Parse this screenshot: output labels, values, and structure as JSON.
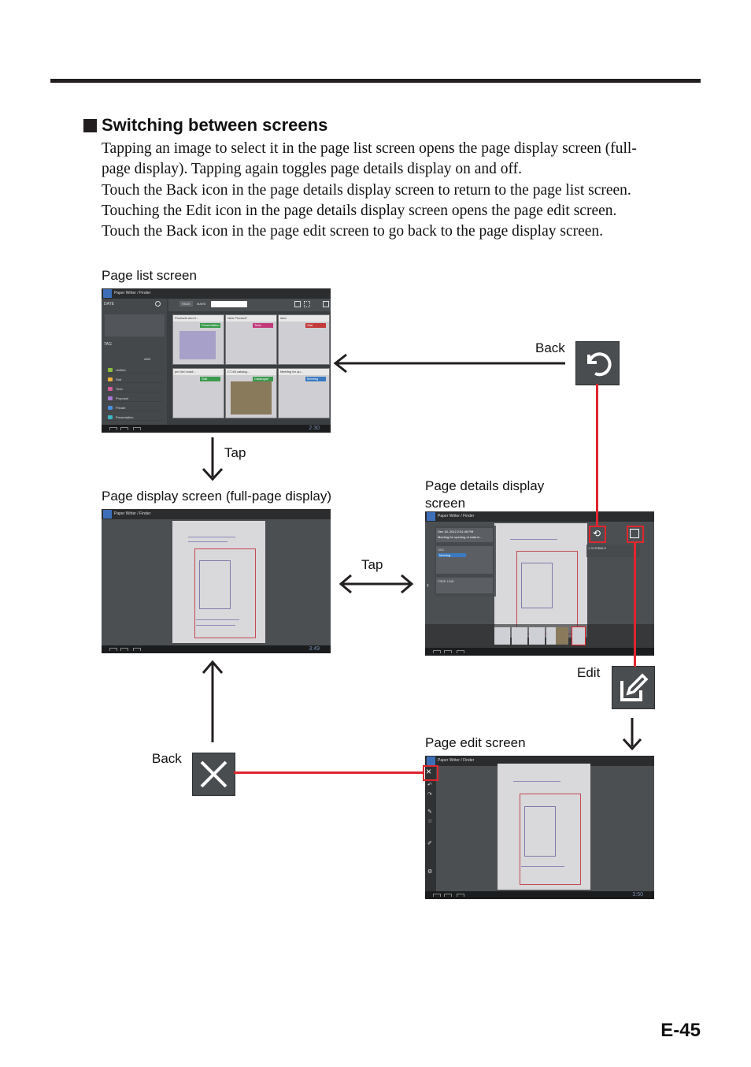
{
  "section": {
    "title": "Switching between screens",
    "paragraph_lines": [
      "Tapping an image to select it in the page list screen opens the page display screen (full-",
      "page display). Tapping again toggles page details display on and off.",
      "Touch the Back icon in the page details display screen to return to the page list screen.",
      "Touching the Edit icon in the page details display screen opens the page edit screen.",
      "Touch the Back icon in the page edit screen to go back to the page display screen."
    ]
  },
  "labels": {
    "page_list": "Page list screen",
    "page_display": "Page display screen (full-page display)",
    "page_details_1": "Page details display",
    "page_details_2": "screen",
    "page_edit": "Page edit screen",
    "tap_down": "Tap",
    "tap_side": "Tap",
    "back_top": "Back",
    "edit": "Edit",
    "back_bottom": "Back"
  },
  "app_title": "Paper Writer / Finder",
  "page_list_screen": {
    "date_label": "DATE",
    "tag_label": "TAG",
    "tab_page": "PAGE",
    "tab_mark": "MARK",
    "and_label": "AND",
    "tags": [
      "Unfiled",
      "Stat",
      "Todo",
      "Proposal",
      "Private",
      "Presentation"
    ],
    "thumbs": [
      {
        "date": "Dec 19, 2012",
        "title": "Products and ti...",
        "tag": "Presentation"
      },
      {
        "date": "Dec 19, 2012",
        "title": "New Product?",
        "tag": "Todo"
      },
      {
        "date": "Dec 18, 2012",
        "title": "idea",
        "tag": "Stat"
      },
      {
        "date": "Dec 19, 2012",
        "title": "pm 3rd Leadi...",
        "tag": "Stat"
      },
      {
        "date": "Dec 19, 2012",
        "title": "CT-63 catalog...",
        "tag": "Catalogue"
      },
      {
        "date": "Dec 18, 2012",
        "title": "Meeting for op...",
        "tag": "Meeting"
      }
    ],
    "clock": "2:30"
  },
  "page_display_screen": {
    "clock": "3:49"
  },
  "page_details_screen": {
    "date": "Dec 18, 2012 2:51:48 PM",
    "title": "Meeting for opening of walk-in...",
    "tag_head": "TAG",
    "tag_value": "Meeting",
    "free_line": "FREE LINE",
    "notes": "1 SCRIBBLE"
  },
  "page_edit_screen": {
    "clock": "3:50"
  },
  "page_number": "E-45",
  "colors": {
    "highlight": "#e0262d",
    "rule": "#231f20"
  }
}
